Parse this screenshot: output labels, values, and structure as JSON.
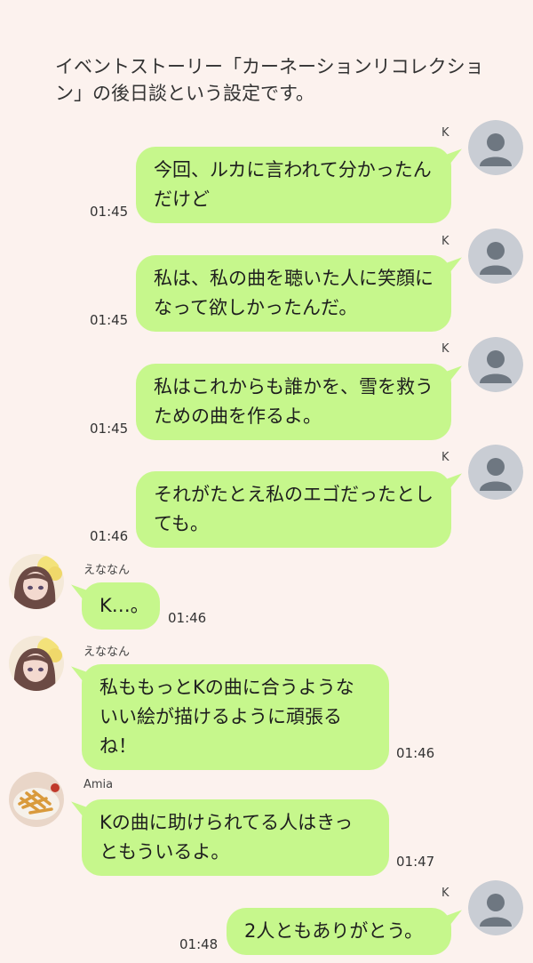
{
  "note": "イベントストーリー「カーネーションリコレクション」の後日談という設定です。",
  "messages": [
    {
      "sender": "K",
      "text": "今回、ルカに言われて分かったんだけど",
      "time": "01:45"
    },
    {
      "sender": "K",
      "text": "私は、私の曲を聴いた人に笑顔になって欲しかったんだ。",
      "time": "01:45"
    },
    {
      "sender": "K",
      "text": "私はこれからも誰かを、雪を救うための曲を作るよ。",
      "time": "01:45"
    },
    {
      "sender": "K",
      "text": "それがたとえ私のエゴだったとしても。",
      "time": "01:46"
    },
    {
      "sender": "えななん",
      "text": "K…。",
      "time": "01:46"
    },
    {
      "sender": "えななん",
      "text": "私ももっとKの曲に合うようないい絵が描けるように頑張るね！",
      "time": "01:46"
    },
    {
      "sender": "Amia",
      "text": "Kの曲に助けられてる人はきっともういるよ。",
      "time": "01:47"
    },
    {
      "sender": "K",
      "text": "2人ともありがとう。",
      "time": "01:48"
    }
  ],
  "colors": {
    "background": "#fcf2ee",
    "bubble": "#c6f78c",
    "default_avatar": "#c9cdd4"
  },
  "icons": {
    "default_avatar": "person-silhouette-icon"
  }
}
